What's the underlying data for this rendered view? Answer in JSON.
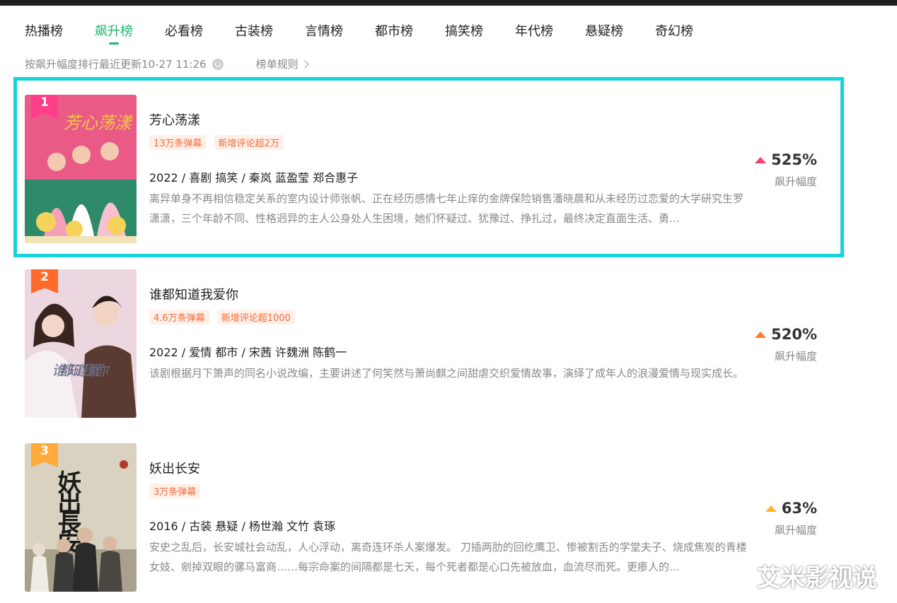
{
  "tabs": [
    "热播榜",
    "飙升榜",
    "必看榜",
    "古装榜",
    "言情榜",
    "都市榜",
    "搞笑榜",
    "年代榜",
    "悬疑榜",
    "奇幻榜"
  ],
  "subbar": {
    "sort_text": "按飙升幅度排行最近更新10-27 11:26",
    "rules_label": "榜单规则"
  },
  "items": [
    {
      "rank": "1",
      "title": "芳心荡漾",
      "tags": [
        "13万条弹幕",
        "新增评论超2万"
      ],
      "meta": "2022 / 喜剧 搞笑 / 秦岚 蓝盈莹 郑合惠子",
      "desc": "离异单身不再相信稳定关系的室内设计师张帆、正在经历感情七年止痒的金牌保险销售潘晓晨和从未经历过恋爱的大学研究生罗潇潇，三个年龄不同、性格迥异的主人公身处人生困境，她们怀疑过、犹豫过、挣扎过，最终决定直面生活、勇…",
      "score": "525%",
      "score_label": "飙升幅度",
      "poster_text": "芳心荡漾"
    },
    {
      "rank": "2",
      "title": "谁都知道我爱你",
      "tags": [
        "4.6万条弹幕",
        "新增评论超1000"
      ],
      "meta": "2022 / 爱情 都市 / 宋茜 许魏洲 陈鹤一",
      "desc": "该剧根据月下箫声的同名小说改编，主要讲述了何笑然与萧尚麒之间甜虐交织爱情故事，演绎了成年人的浪漫爱情与现实成长。",
      "score": "520%",
      "score_label": "飙升幅度",
      "poster_text": "谁都知道我爱你"
    },
    {
      "rank": "3",
      "title": "妖出长安",
      "tags": [
        "3万条弹幕"
      ],
      "meta": "2016 / 古装 悬疑 / 杨世瀚 文竹 袁琢",
      "desc": "安史之乱后，长安城社会动乱，人心浮动，离奇连环杀人案爆发。 刀插两肋的回纥鹰卫、惨被割舌的学堂夫子、烧成焦炭的青楼女妓、剜掉双眼的骡马富商……每宗命案的间隔都是七天，每个死者都是心口先被放血，血流尽而死。更瘆人的…",
      "score": "63%",
      "score_label": "飙升幅度",
      "poster_text": "妖出長安"
    }
  ],
  "watermark": "艾米影视说",
  "colors": {
    "accent": "#1fb66f",
    "highlight": "#17d4d9",
    "rank1": "#ff3e88",
    "rank2": "#ff6a2b",
    "rank3": "#ffaa3a",
    "tag_text": "#f26b3a"
  }
}
